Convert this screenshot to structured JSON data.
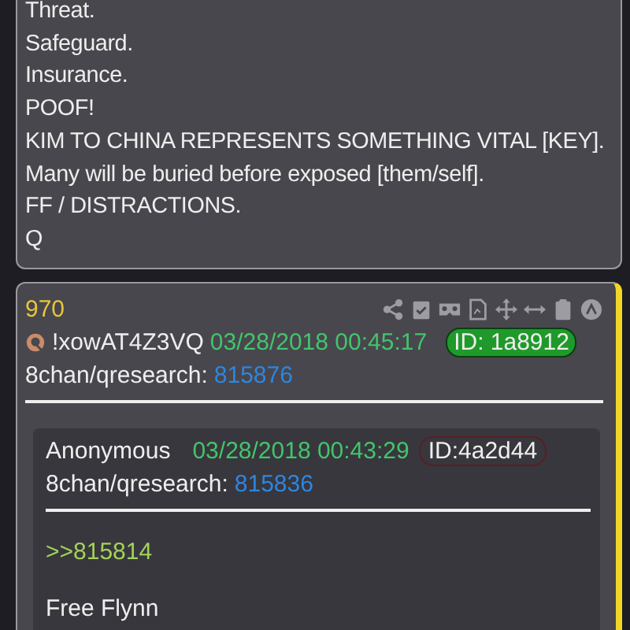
{
  "top_post": {
    "lines": [
      "Threat.",
      "Safeguard.",
      "Insurance.",
      "POOF!",
      "KIM TO CHINA REPRESENTS SOMETHING VITAL [KEY].",
      "Many will be buried before exposed [them/self].",
      "FF / DISTRACTIONS.",
      "Q"
    ]
  },
  "post": {
    "number": "970",
    "tripcode": "!xowAT4Z3VQ",
    "date": "03/28/2018 00:45:17",
    "id": "ID: 1a8912",
    "board": "8chan/qresearch:",
    "link": "815876",
    "toolbar": [
      {
        "kind": "share"
      },
      {
        "kind": "clipcheck"
      },
      {
        "kind": "goggles"
      },
      {
        "kind": "doc"
      },
      {
        "kind": "move"
      },
      {
        "kind": "hresize"
      },
      {
        "kind": "clipboard"
      },
      {
        "kind": "circle"
      }
    ],
    "quote": {
      "name": "Anonymous",
      "date": "03/28/2018 00:43:29",
      "id": "ID:4a2d44",
      "board": "8chan/qresearch:",
      "link": "815836",
      "lines": [
        {
          "kind": "reply",
          "text": ">>815814"
        },
        {
          "kind": "text",
          "text": "Free Flynn"
        }
      ]
    }
  }
}
